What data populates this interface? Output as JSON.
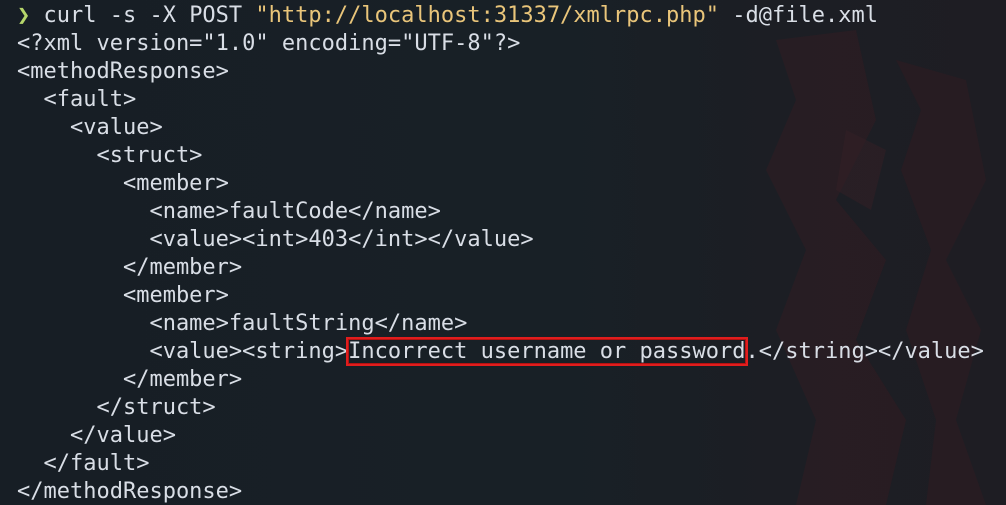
{
  "terminal": {
    "prompt_symbol": "❯",
    "command": {
      "prefix": " curl -s -X POST ",
      "url": "\"http://localhost:31337/xmlrpc.php\"",
      "suffix": " -d@file.xml"
    },
    "output": {
      "line01": "<?xml version=\"1.0\" encoding=\"UTF-8\"?>",
      "line02": "<methodResponse>",
      "line03": "  <fault>",
      "line04": "    <value>",
      "line05": "      <struct>",
      "line06": "        <member>",
      "line07": "          <name>faultCode</name>",
      "line08": "          <value><int>403</int></value>",
      "line09": "        </member>",
      "line10": "        <member>",
      "line11": "          <name>faultString</name>",
      "line12": {
        "prefix": "          <value><string>",
        "highlighted": "Incorrect username or password",
        "suffix": ".</string></value>"
      },
      "line13": "        </member>",
      "line14": "      </struct>",
      "line15": "    </value>",
      "line16": "  </fault>",
      "line17": "</methodResponse>"
    }
  },
  "colors": {
    "background": "#171e25",
    "text": "#d9dee6",
    "prompt": "#b6d66b",
    "string": "#e9c57a",
    "highlight_box": "#e01d1d"
  }
}
